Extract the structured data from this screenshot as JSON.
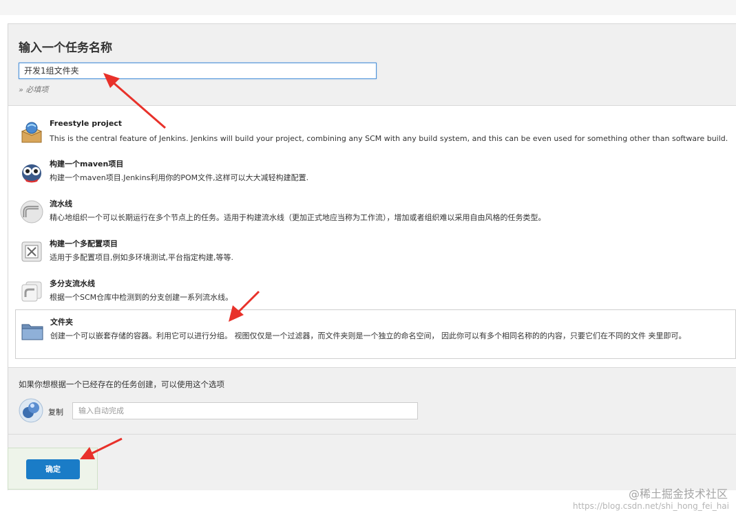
{
  "form": {
    "title": "输入一个任务名称",
    "name_value": "开发1组文件夹",
    "required_hint": "» 必填项"
  },
  "job_types": [
    {
      "name": "Freestyle project",
      "description": "This is the central feature of Jenkins. Jenkins will build your project, combining any SCM with any build system, and this can be even used for something other than software build.",
      "icon": "freestyle-box-icon"
    },
    {
      "name": "构建一个maven项目",
      "description": "构建一个maven项目.Jenkins利用你的POM文件,这样可以大大减轻构建配置.",
      "icon": "maven-owl-icon"
    },
    {
      "name": "流水线",
      "description": "精心地组织一个可以长期运行在多个节点上的任务。适用于构建流水线（更加正式地应当称为工作流），增加或者组织难以采用自由风格的任务类型。",
      "icon": "pipeline-icon"
    },
    {
      "name": "构建一个多配置项目",
      "description": "适用于多配置项目,例如多环境测试,平台指定构建,等等.",
      "icon": "multi-config-icon"
    },
    {
      "name": "多分支流水线",
      "description": "根据一个SCM仓库中检测到的分支创建一系列流水线。",
      "icon": "multibranch-pipeline-icon"
    },
    {
      "name": "文件夹",
      "description": "创建一个可以嵌套存储的容器。利用它可以进行分组。 视图仅仅是一个过滤器，而文件夹则是一个独立的命名空间， 因此你可以有多个相同名称的的内容，只要它们在不同的文件 夹里即可。",
      "icon": "folder-icon"
    }
  ],
  "copy": {
    "hint": "如果你想根据一个已经存在的任务创建，可以使用这个选项",
    "label": "复制",
    "placeholder": "输入自动完成"
  },
  "ok_button": {
    "label": "确定"
  },
  "watermark": {
    "site": "@稀土掘金技术社区",
    "url": "https://blog.csdn.net/shi_hong_fei_hai"
  },
  "colors": {
    "accent": "#1a7cc7",
    "annotation_arrow": "#e8312a"
  }
}
